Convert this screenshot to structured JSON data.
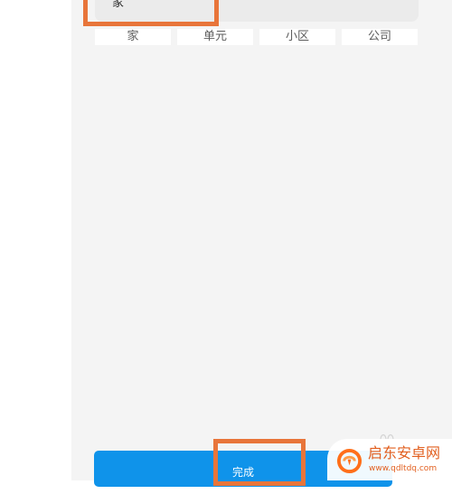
{
  "address_label": {
    "input_value": "家"
  },
  "quick_tags": [
    "家",
    "单元",
    "小区",
    "公司"
  ],
  "footer": {
    "done_label": "完成"
  },
  "watermark": {
    "title": "启东安卓网",
    "url": "www.qdltdq.com"
  },
  "colors": {
    "highlight": "#e8753a",
    "primary": "#0f93ea",
    "background": "#f4f4f4",
    "watermark_text": "#e25f1f"
  }
}
